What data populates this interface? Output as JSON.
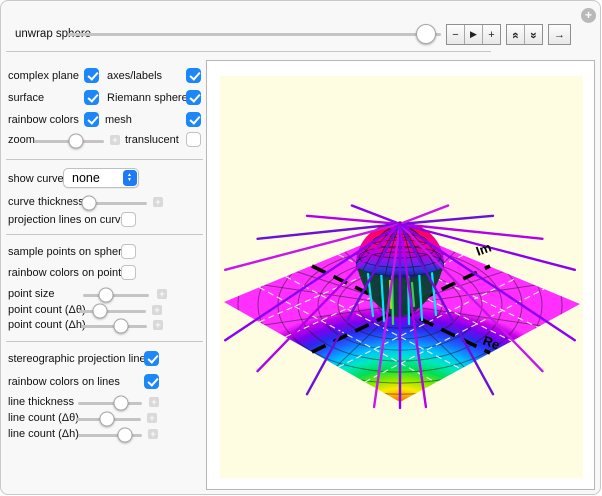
{
  "colors": {
    "checkbox_accent": "#1d87f8",
    "plot_background": "#fffde1",
    "projection_line_purple": "#8a00f0",
    "plane_corner_magenta": "#ff30ff"
  },
  "icons": {
    "menu_plus": "+",
    "expand_plus": "+",
    "dropdown_up": "▲",
    "dropdown_down": "▼"
  },
  "toolbar": {
    "label": "unwrap sphere",
    "slider_position": 0.96,
    "buttons": [
      {
        "name": "decrement",
        "glyph": "−"
      },
      {
        "name": "play",
        "glyph": "▶"
      },
      {
        "name": "increment",
        "glyph": "+"
      },
      {
        "name": "faster",
        "glyph": "«"
      },
      {
        "name": "slower",
        "glyph": "»"
      },
      {
        "name": "direction",
        "glyph": "→"
      }
    ]
  },
  "controls": {
    "complex_plane": {
      "label": "complex plane",
      "checked": true
    },
    "axes_labels": {
      "label": "axes/labels",
      "checked": true
    },
    "surface": {
      "label": "surface",
      "checked": true
    },
    "riemann_sphere": {
      "label": "Riemann sphere",
      "checked": true
    },
    "rainbow_colors": {
      "label": "rainbow colors",
      "checked": true
    },
    "mesh": {
      "label": "mesh",
      "checked": true
    },
    "zoom": {
      "label": "zoom",
      "value": 0.6
    },
    "translucent": {
      "label": "translucent",
      "checked": false
    },
    "show_curve": {
      "label": "show curve",
      "value": "none"
    },
    "curve_thickness": {
      "label": "curve thickness",
      "value": 0.12
    },
    "projection_lines_on_curve": {
      "label": "projection lines on curve",
      "checked": false
    },
    "sample_points_on_sphere": {
      "label": "sample points on sphere",
      "checked": false
    },
    "rainbow_colors_on_points": {
      "label": "rainbow colors on points",
      "checked": false
    },
    "point_size": {
      "label": "point size",
      "value": 0.35
    },
    "point_count_dtheta": {
      "label": "point count (Δθ)",
      "value": 0.32
    },
    "point_count_dh": {
      "label": "point count (Δh)",
      "value": 0.6
    },
    "stereographic_projection_lines": {
      "label": "stereographic projection lines",
      "checked": true
    },
    "rainbow_colors_on_lines": {
      "label": "rainbow colors on lines",
      "checked": true
    },
    "line_thickness": {
      "label": "line thickness",
      "value": 0.67
    },
    "line_count_dtheta": {
      "label": "line count (Δθ)",
      "value": 0.48
    },
    "line_count_dh": {
      "label": "line count (Δh)",
      "value": 0.73
    }
  },
  "graphic": {
    "re_label": "Re",
    "im_label": "Im",
    "description": "Riemann sphere being unwrapped onto the complex plane with stereographic projection lines"
  }
}
